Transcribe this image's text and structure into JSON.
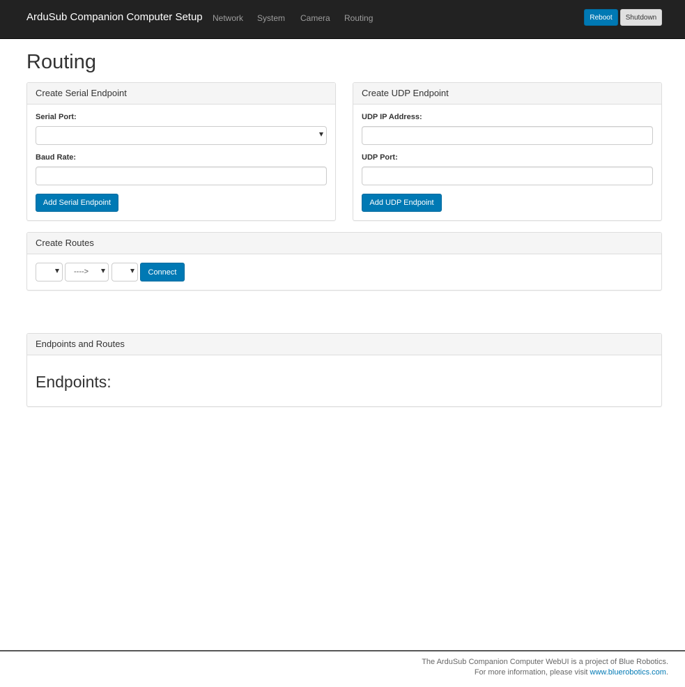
{
  "navbar": {
    "brand": "ArduSub Companion Computer Setup",
    "links": [
      "Network",
      "System",
      "Camera",
      "Routing"
    ],
    "reboot_label": "Reboot",
    "shutdown_label": "Shutdown"
  },
  "page": {
    "title": "Routing"
  },
  "serial_panel": {
    "heading": "Create Serial Endpoint",
    "serial_port_label": "Serial Port:",
    "serial_port_value": "",
    "baud_rate_label": "Baud Rate:",
    "baud_rate_value": "",
    "add_button": "Add Serial Endpoint"
  },
  "udp_panel": {
    "heading": "Create UDP Endpoint",
    "ip_label": "UDP IP Address:",
    "ip_value": "",
    "port_label": "UDP Port:",
    "port_value": "",
    "add_button": "Add UDP Endpoint"
  },
  "routes_panel": {
    "heading": "Create Routes",
    "source_value": "",
    "direction_value": "---->",
    "target_value": "",
    "connect_button": "Connect"
  },
  "endpoints_panel": {
    "heading": "Endpoints and Routes",
    "endpoints_title": "Endpoints:"
  },
  "footer": {
    "line1": "The ArduSub Companion Computer WebUI is a project of Blue Robotics.",
    "line2_prefix": "For more information, please visit ",
    "link_text": "www.bluerobotics.com",
    "line2_suffix": "."
  },
  "colors": {
    "navbar_bg": "#222222",
    "primary": "#0079b4",
    "panel_heading_bg": "#f5f5f5"
  }
}
